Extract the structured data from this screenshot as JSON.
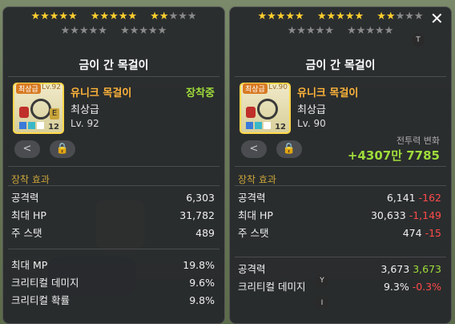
{
  "background": {
    "texts": []
  },
  "left": {
    "stars_row1": [
      "★★★★★",
      "★★★★★",
      "★★"
    ],
    "stars_row1_off": [
      "",
      "",
      "★★★"
    ],
    "stars_row2_off": [
      "★★★★★",
      "★★★★★"
    ],
    "title": "금이 간 목걸이",
    "icon": {
      "tier": "최상급",
      "level": "Lv.92",
      "badge": "E",
      "count": "12"
    },
    "item_type": "유니크 목걸이",
    "grade": "최상급",
    "level": "Lv. 92",
    "equipped": "장착중",
    "section": "장착 효과",
    "stats_main": [
      {
        "label": "공격력",
        "value": "6,303"
      },
      {
        "label": "최대 HP",
        "value": "31,782"
      },
      {
        "label": "주 스탯",
        "value": "489"
      }
    ],
    "stats_sub": [
      {
        "label": "최대 MP",
        "value": "19.8%"
      },
      {
        "label": "크리티컬 데미지",
        "value": "9.6%"
      },
      {
        "label": "크리티컬 확률",
        "value": "9.8%"
      }
    ]
  },
  "right": {
    "stars_row1": [
      "★★★★★",
      "★★★★★",
      "★★"
    ],
    "stars_row1_off": [
      "",
      "",
      "★★★"
    ],
    "stars_row2_off": [
      "★★★★★",
      "★★★★★"
    ],
    "title": "금이 간 목걸이",
    "icon": {
      "tier": "최상급",
      "level": "Lv.90",
      "count": "12"
    },
    "item_type": "유니크 목걸이",
    "grade": "최상급",
    "level": "Lv. 90",
    "cp_label": "전투력 변화",
    "cp_value": "+4307만 7785",
    "section": "장착 효과",
    "stats_main": [
      {
        "label": "공격력",
        "value": "6,141",
        "diff": "-162"
      },
      {
        "label": "최대 HP",
        "value": "30,633",
        "diff": "-1,149"
      },
      {
        "label": "주 스탯",
        "value": "474",
        "diff": "-15"
      }
    ],
    "stats_sub": [
      {
        "label": "공격력",
        "value": "3,673",
        "diff": "3,673"
      },
      {
        "label": "크리티컬 데미지",
        "value": "9.3%",
        "diff": "-0.3%"
      }
    ]
  },
  "close_icon": "✕",
  "keys": {
    "t": "T",
    "y": "Y",
    "i": "I"
  },
  "icons": {
    "share": "share-icon",
    "lock": "lock-icon",
    "close": "close-icon"
  },
  "colors": {
    "star": "#ffcf2e",
    "equipped": "#9fdc3a",
    "negative": "#ff4a4a",
    "positive": "#9fdc3a",
    "section": "#c9a43a",
    "item_type": "#ffb43a"
  }
}
